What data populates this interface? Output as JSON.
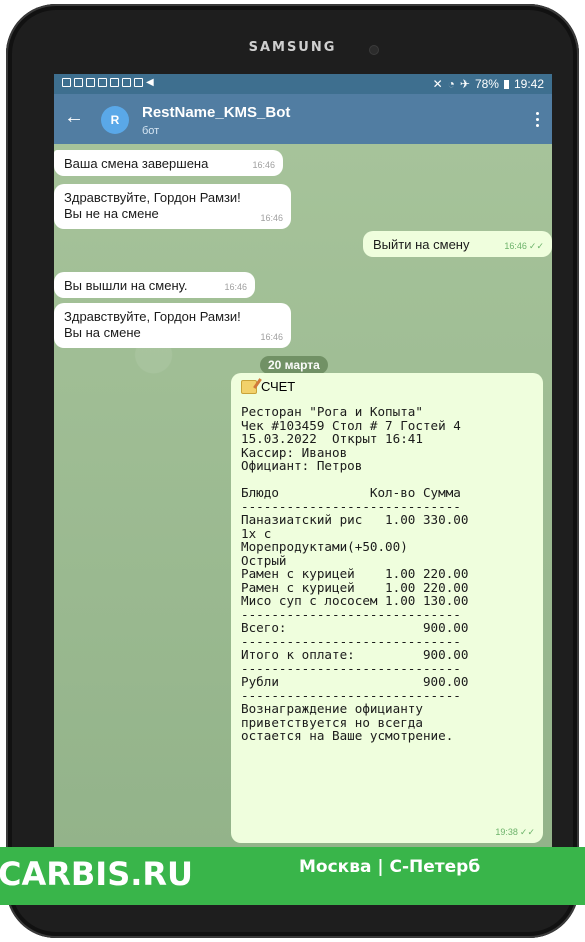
{
  "device": {
    "brand": "SAMSUNG"
  },
  "status_bar": {
    "battery": "78%",
    "time": "19:42"
  },
  "header": {
    "avatar_letter": "R",
    "title": "RestName_KMS_Bot",
    "subtitle": "бот"
  },
  "messages": [
    {
      "text_lines": [
        "Ваша смена завершена"
      ],
      "time": "16:46",
      "direction": "in"
    },
    {
      "text_lines": [
        "Здравствуйте, Гордон Рамзи!",
        "Вы не на смене"
      ],
      "time": "16:46",
      "direction": "in"
    },
    {
      "text_lines": [
        "Выйти на смену"
      ],
      "time": "16:46",
      "direction": "out",
      "checks": "✓✓"
    },
    {
      "text_lines": [
        "Вы вышли на смену."
      ],
      "time": "16:46",
      "direction": "in"
    },
    {
      "text_lines": [
        "Здравствуйте, Гордон Рамзи!",
        "Вы на смене"
      ],
      "time": "16:46",
      "direction": "in"
    }
  ],
  "date_separator": "20 марта",
  "receipt": {
    "header": "СЧЕТ",
    "lines": [
      "Ресторан \"Рога и Копыта\"",
      "Чек #103459 Стол # 7 Гостей 4",
      "15.03.2022  Открыт 16:41",
      "Кассир: Иванов",
      "Официант: Петров",
      "",
      "Блюдо            Кол-во Сумма",
      "-----------------------------",
      "Паназиатский рис   1.00 330.00",
      "1х с",
      "Морепродуктами(+50.00)",
      "Острый",
      "Рамен с курицей    1.00 220.00",
      "Рамен с курицей    1.00 220.00",
      "Мисо суп с лососем 1.00 130.00",
      "-----------------------------",
      "Всего:                  900.00",
      "-----------------------------",
      "Итого к оплате:         900.00",
      "-----------------------------",
      "Рубли                   900.00",
      "-----------------------------",
      "Вознаграждение официанту",
      "приветствуется но всегда",
      "остается на Ваше усмотрение."
    ],
    "time": "19:38",
    "checks": "✓✓"
  },
  "banner": {
    "left_text": "CARBIS.RU",
    "right_text": "Москва | С-Петерб"
  },
  "colors": {
    "header": "#517da2",
    "status_bar": "#3e6f8f",
    "outgoing_bubble": "#effedd",
    "banner": "#39b54a"
  }
}
